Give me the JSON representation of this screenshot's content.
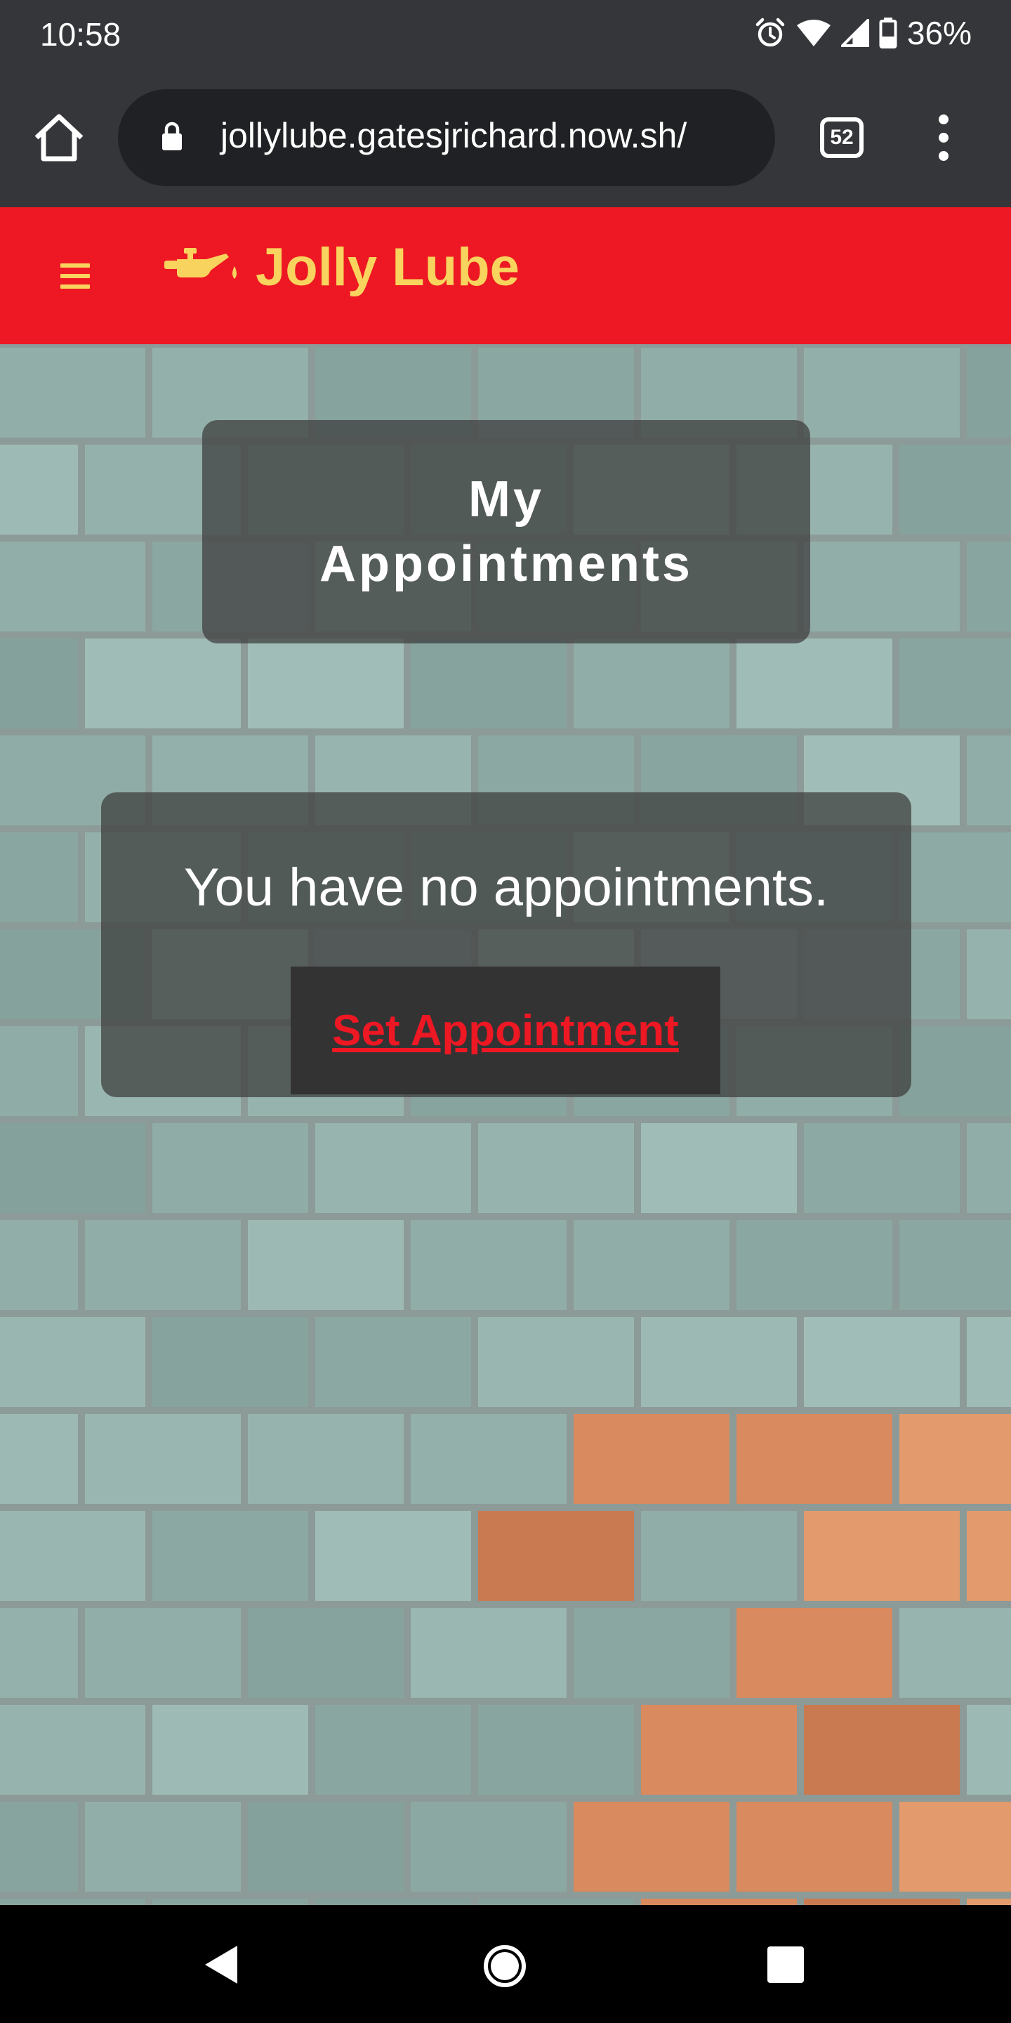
{
  "status_bar": {
    "time": "10:58",
    "battery": "36%"
  },
  "browser": {
    "url": "jollylube.gatesjrichard.now.sh/",
    "tab_count": "52"
  },
  "header": {
    "brand": "Jolly Lube",
    "brand_color": "#f8d35d",
    "background_color": "#ed1823"
  },
  "main": {
    "title": "My Appointments",
    "empty_message": "You have no appointments.",
    "set_appointment_label": "Set Appointment"
  }
}
